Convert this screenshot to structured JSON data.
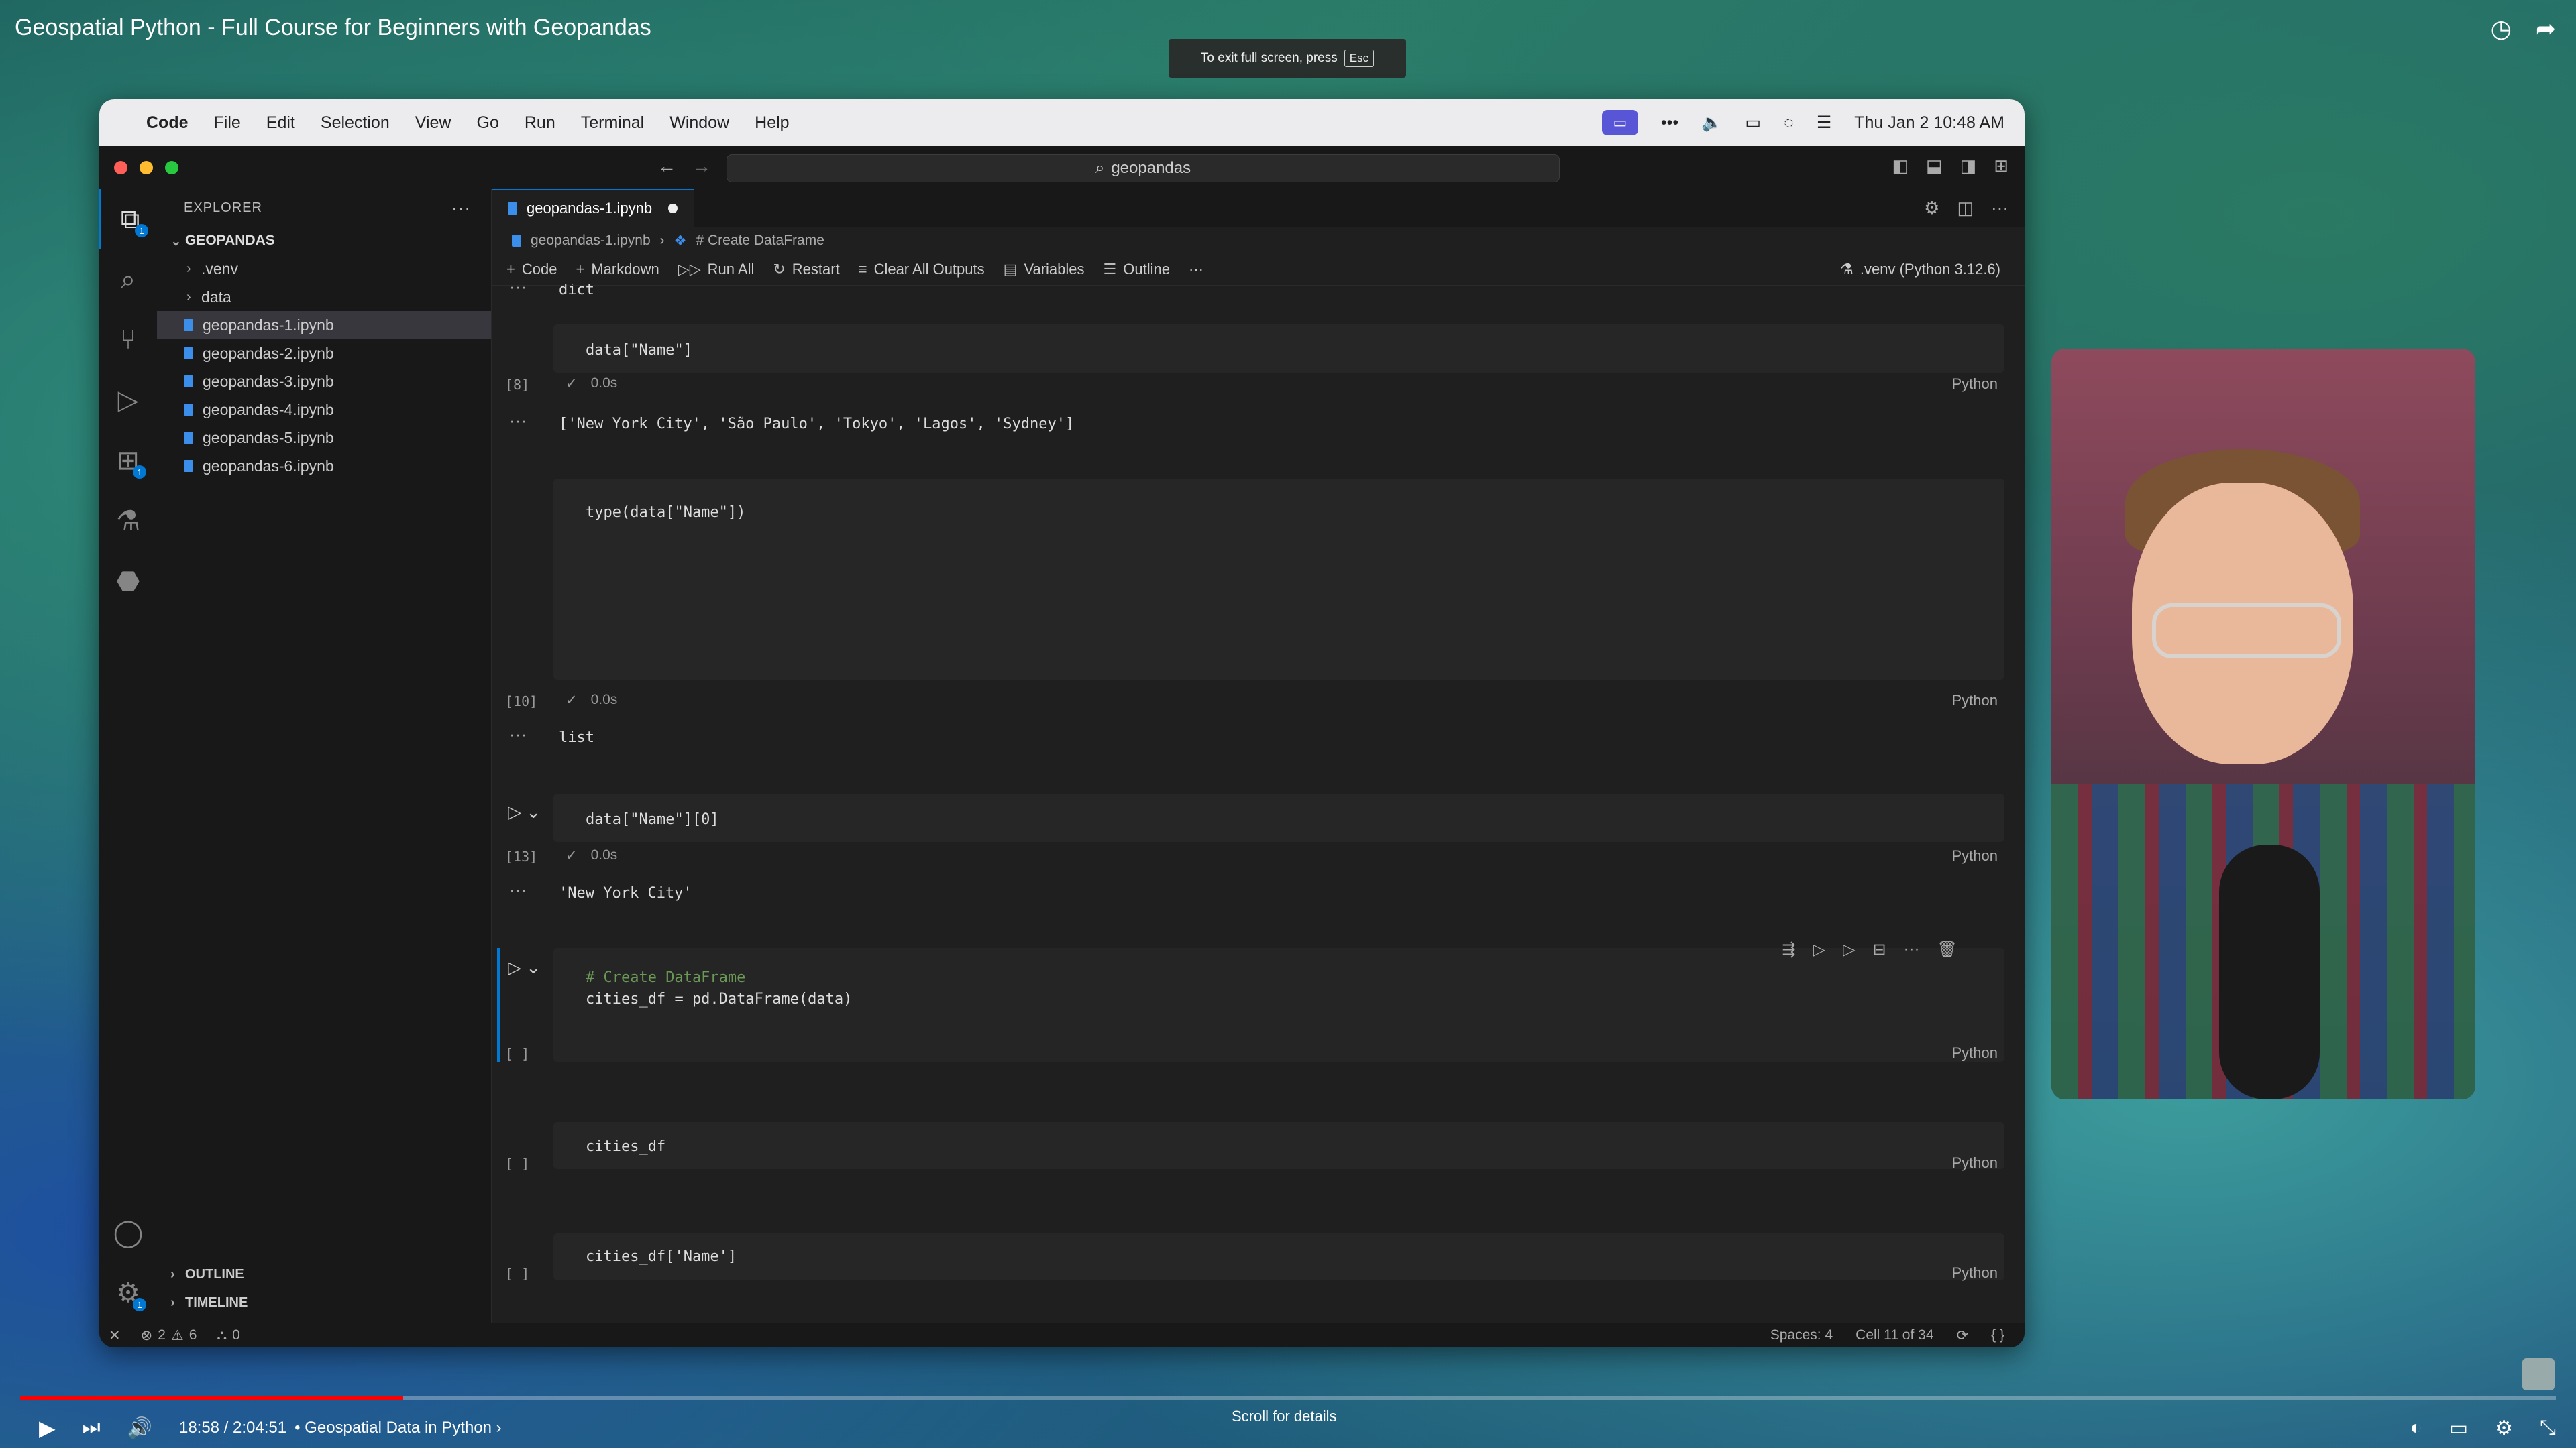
{
  "video": {
    "title": "Geospatial Python - Full Course for Beginners with Geopandas",
    "fullscreen_hint": "To exit full screen, press",
    "fullscreen_key": "Esc",
    "time": "18:58 / 2:04:51",
    "chapter": "• Geospatial Data in Python ›",
    "scroll_hint": "Scroll for details",
    "progress_fraction": 0.151
  },
  "menubar": {
    "app": "Code",
    "items": [
      "File",
      "Edit",
      "Selection",
      "View",
      "Go",
      "Run",
      "Terminal",
      "Window",
      "Help"
    ],
    "clock": "Thu Jan 2  10:48 AM"
  },
  "titlebar": {
    "search": "geopandas"
  },
  "sidebar": {
    "header": "EXPLORER",
    "root": "GEOPANDAS",
    "folders": [
      ".venv",
      "data"
    ],
    "files": [
      "geopandas-1.ipynb",
      "geopandas-2.ipynb",
      "geopandas-3.ipynb",
      "geopandas-4.ipynb",
      "geopandas-5.ipynb",
      "geopandas-6.ipynb"
    ],
    "outline": "OUTLINE",
    "timeline": "TIMELINE"
  },
  "editor": {
    "tab": "geopandas-1.ipynb",
    "breadcrumb_file": "geopandas-1.ipynb",
    "breadcrumb_section": "# Create DataFrame",
    "toolbar": {
      "code": "Code",
      "markdown": "Markdown",
      "run_all": "Run All",
      "restart": "Restart",
      "clear": "Clear All Outputs",
      "variables": "Variables",
      "outline": "Outline",
      "kernel": ".venv (Python 3.12.6)"
    }
  },
  "cells": {
    "top_output": "dict",
    "c8": {
      "code": "data[\"Name\"]",
      "num": "[8]",
      "time": "0.0s",
      "lang": "Python",
      "output": "['New York City', 'São Paulo', 'Tokyo', 'Lagos', 'Sydney']"
    },
    "c10": {
      "code": "type(data[\"Name\"])",
      "num": "[10]",
      "time": "0.0s",
      "lang": "Python",
      "output": "list"
    },
    "c13": {
      "code": "data[\"Name\"][0]",
      "num": "[13]",
      "time": "0.0s",
      "lang": "Python",
      "output": "'New York City'"
    },
    "c_df": {
      "comment": "# Create DataFrame",
      "code": "cities_df = pd.DataFrame(data)",
      "num": "[ ]",
      "lang": "Python"
    },
    "c_df2": {
      "code": "cities_df",
      "num": "[ ]",
      "lang": "Python"
    },
    "c_df3": {
      "code": "cities_df['Name']",
      "num": "[ ]",
      "lang": "Python"
    }
  },
  "statusbar": {
    "errors": "2",
    "warnings": "6",
    "ports": "0",
    "spaces": "Spaces: 4",
    "cell": "Cell 11 of 34"
  }
}
